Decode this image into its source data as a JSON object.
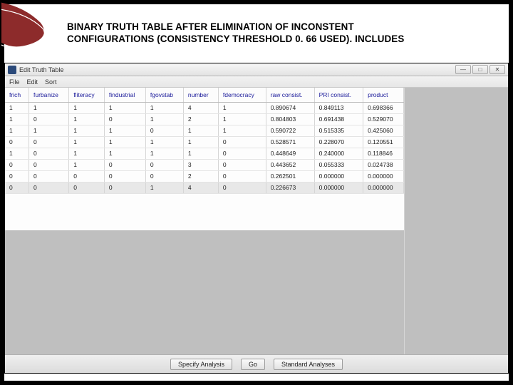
{
  "slide": {
    "title_line1": "BINARY TRUTH TABLE AFTER ELIMINATION OF INCONSTENT",
    "title_line2": "CONFIGURATIONS  (CONSISTENCY THRESHOLD 0. 66 USED). INCLUDES"
  },
  "window": {
    "title": "Edit Truth Table",
    "menus": {
      "file": "File",
      "edit": "Edit",
      "sort": "Sort"
    }
  },
  "win_controls": {
    "min": "—",
    "max": "□",
    "close": "✕"
  },
  "table": {
    "headers": [
      "frich",
      "furbanize",
      "fliteracy",
      "findustrial",
      "fgovstab",
      "number",
      "fdemocracy",
      "raw consist.",
      "PRI consist.",
      "product"
    ],
    "rows": [
      [
        "1",
        "1",
        "1",
        "1",
        "1",
        "4",
        "1",
        "0.890674",
        "0.849113",
        "0.698366"
      ],
      [
        "1",
        "0",
        "1",
        "0",
        "1",
        "2",
        "1",
        "0.804803",
        "0.691438",
        "0.529070"
      ],
      [
        "1",
        "1",
        "1",
        "1",
        "0",
        "1",
        "1",
        "0.590722",
        "0.515335",
        "0.425060"
      ],
      [
        "0",
        "0",
        "1",
        "1",
        "1",
        "1",
        "0",
        "0.528571",
        "0.228070",
        "0.120551"
      ],
      [
        "1",
        "0",
        "1",
        "1",
        "1",
        "1",
        "0",
        "0.448649",
        "0.240000",
        "0.118846"
      ],
      [
        "0",
        "0",
        "1",
        "0",
        "0",
        "3",
        "0",
        "0.443652",
        "0.055333",
        "0.024738"
      ],
      [
        "0",
        "0",
        "0",
        "0",
        "0",
        "2",
        "0",
        "0.262501",
        "0.000000",
        "0.000000"
      ],
      [
        "0",
        "0",
        "0",
        "0",
        "1",
        "4",
        "0",
        "0.226673",
        "0.000000",
        "0.000000"
      ]
    ]
  },
  "buttons": {
    "specify": "Specify Analysis",
    "go": "Go",
    "std": "Standard Analyses"
  }
}
